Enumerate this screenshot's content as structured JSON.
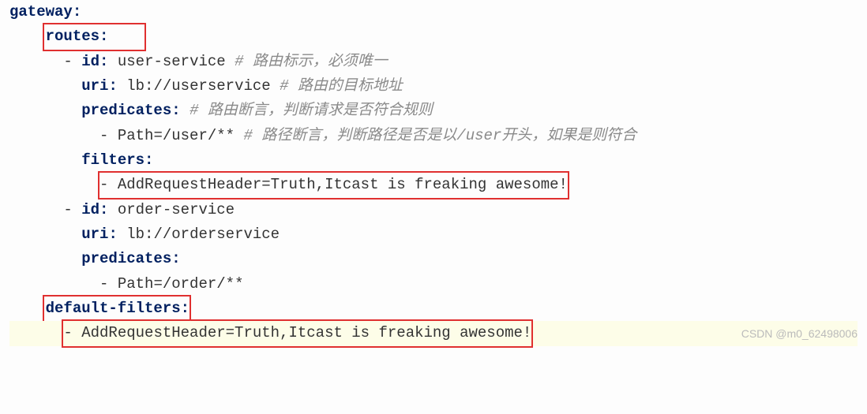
{
  "lines": {
    "l1_key": "gateway",
    "l2_key": "routes",
    "l3_key": "id",
    "l3_val": "user-service",
    "l3_comment": "# 路由标示，必须唯一",
    "l4_key": "uri",
    "l4_val": "lb://userservice",
    "l4_comment": "# 路由的目标地址",
    "l5_key": "predicates",
    "l5_comment": "# 路由断言，判断请求是否符合规则",
    "l6_val": "Path=/user/**",
    "l6_comment": "# 路径断言，判断路径是否是以/user开头，如果是则符合",
    "l7_key": "filters",
    "l8_val": "- AddRequestHeader=Truth,Itcast is freaking awesome!",
    "l9_key": "id",
    "l9_val": "order-service",
    "l10_key": "uri",
    "l10_val": "lb://orderservice",
    "l11_key": "predicates",
    "l12_val": "Path=/order/**",
    "l13_key": "default-filters",
    "l14_val": "- AddRequestHeader=Truth,Itcast is freaking awesome!"
  },
  "watermark": "CSDN @m0_62498006"
}
